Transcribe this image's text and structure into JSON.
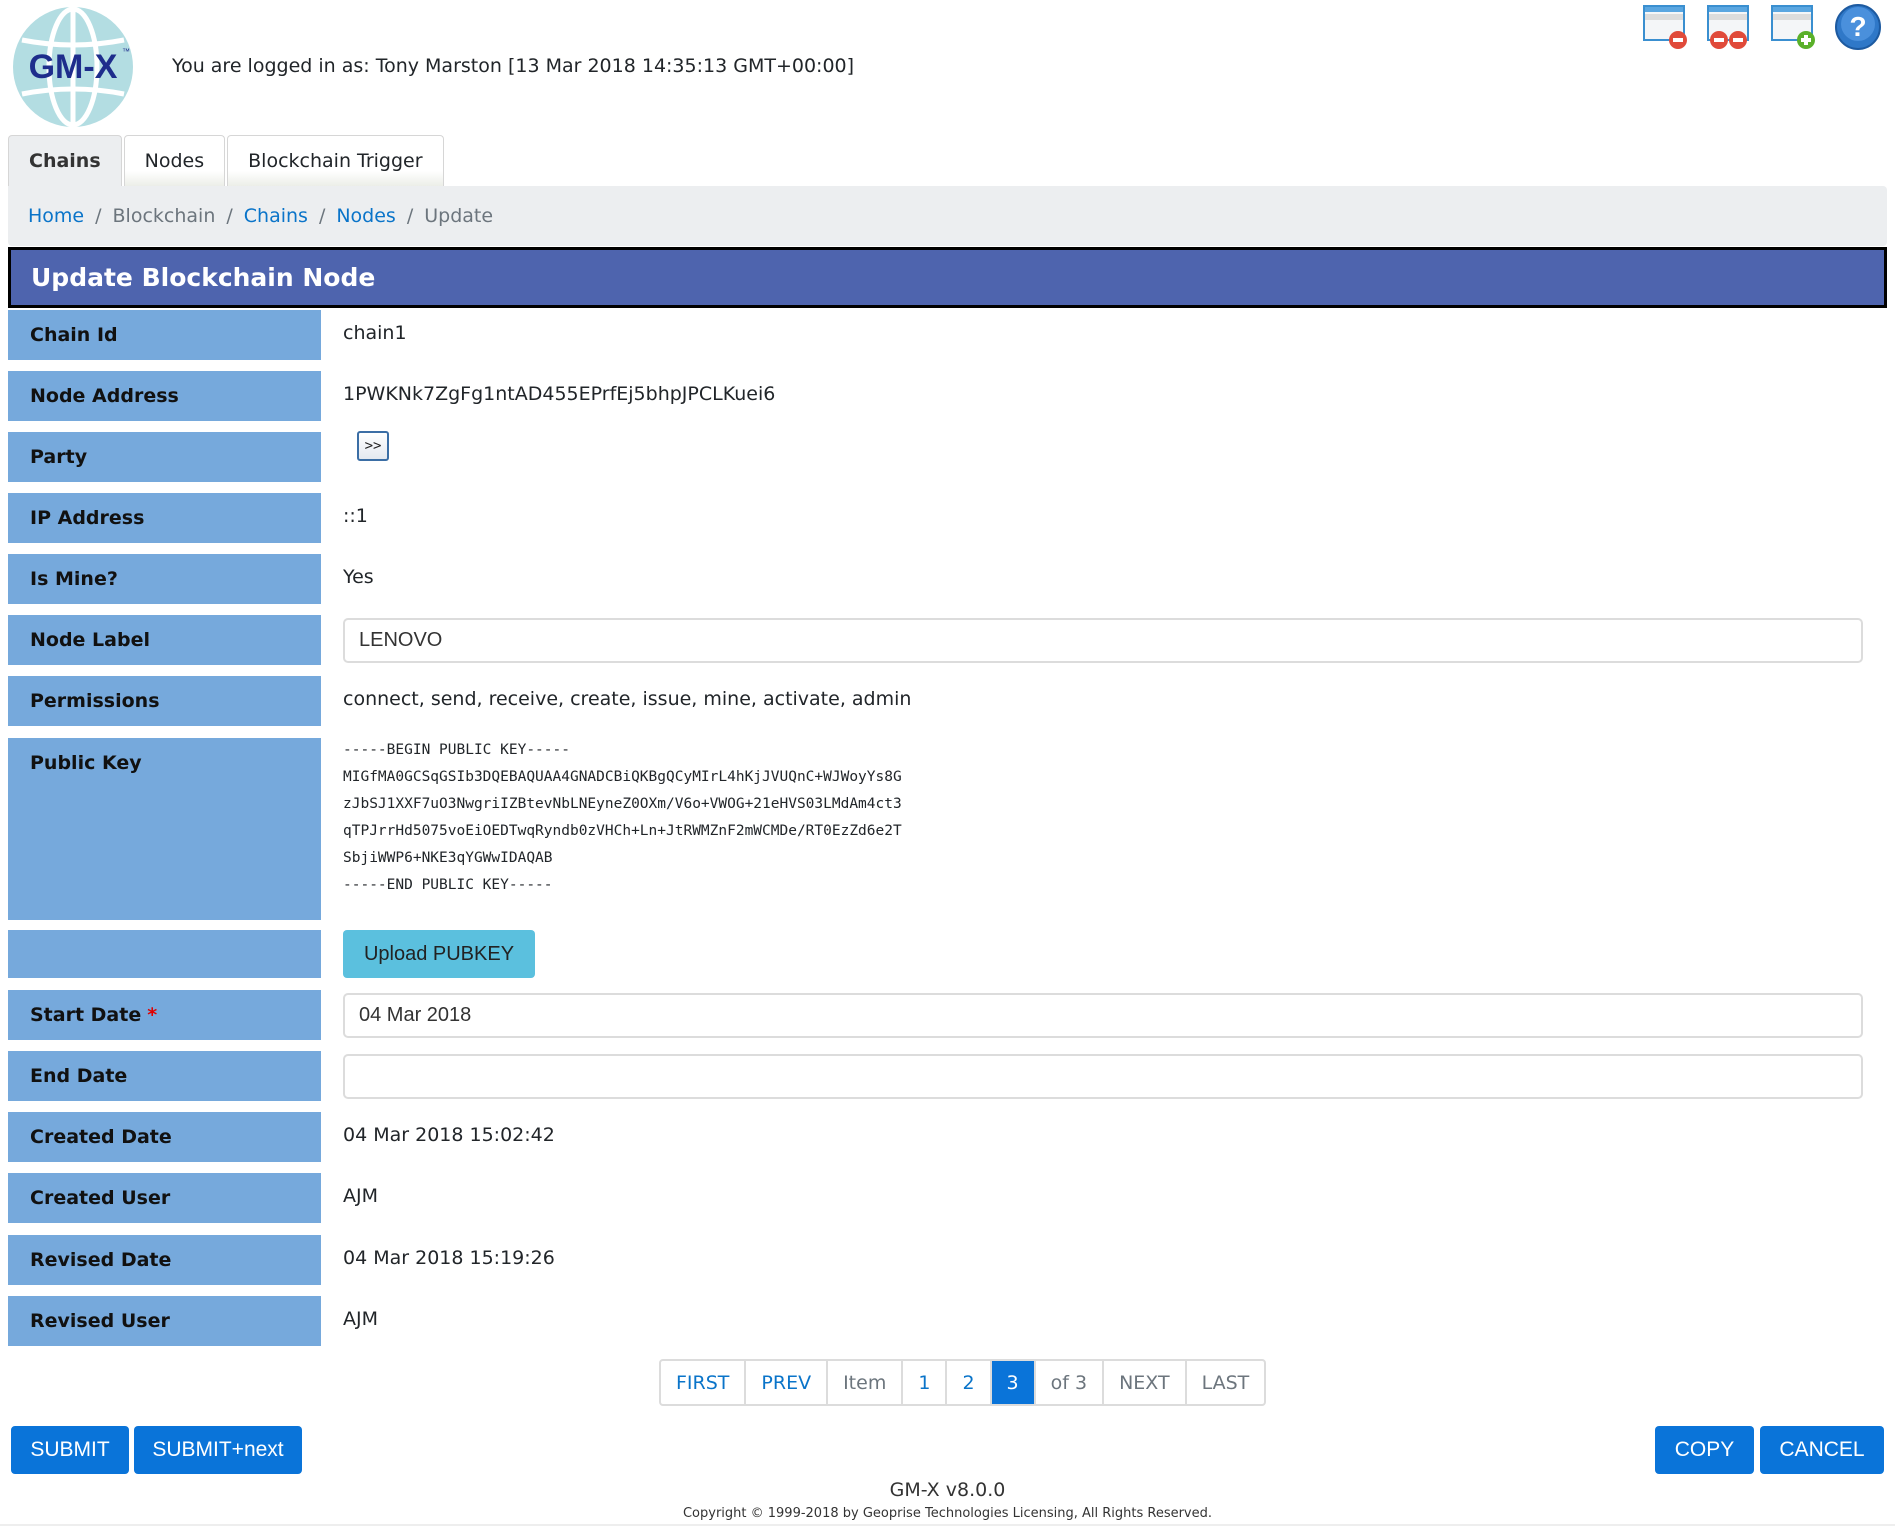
{
  "header": {
    "logo_text": "GM-X",
    "logo_tm": "™",
    "logged_in_text": "You are logged in as: Tony Marston [13 Mar 2018 14:35:13 GMT+00:00]",
    "icons": [
      {
        "name": "close-window-icon"
      },
      {
        "name": "close-all-windows-icon"
      },
      {
        "name": "new-window-icon"
      },
      {
        "name": "help-icon"
      }
    ]
  },
  "tabs": [
    {
      "label": "Chains",
      "active": true
    },
    {
      "label": "Nodes",
      "active": false
    },
    {
      "label": "Blockchain Trigger",
      "active": false
    }
  ],
  "breadcrumb": {
    "items": [
      {
        "label": "Home",
        "link": true
      },
      {
        "label": "Blockchain",
        "link": false
      },
      {
        "label": "Chains",
        "link": true
      },
      {
        "label": "Nodes",
        "link": true
      },
      {
        "label": "Update",
        "link": false
      }
    ],
    "separator": "/"
  },
  "title": "Update Blockchain Node",
  "fields": {
    "chain_id": {
      "label": "Chain Id",
      "value": "chain1"
    },
    "node_address": {
      "label": "Node Address",
      "value": "1PWKNk7ZgFg1ntAD455EPrfEj5bhpJPCLKuei6"
    },
    "party": {
      "label": "Party",
      "button_label": ">>"
    },
    "ip_address": {
      "label": "IP Address",
      "value": "::1"
    },
    "is_mine": {
      "label": "Is Mine?",
      "value": "Yes"
    },
    "node_label": {
      "label": "Node Label",
      "value": "LENOVO"
    },
    "permissions": {
      "label": "Permissions",
      "value": "connect, send, receive, create, issue, mine, activate, admin"
    },
    "public_key": {
      "label": "Public Key",
      "value": "-----BEGIN PUBLIC KEY-----\nMIGfMA0GCSqGSIb3DQEBAQUAA4GNADCBiQKBgQCyMIrL4hKjJVUQnC+WJWoyYs8G\nzJbSJ1XXF7uO3NwgriIZBtevNbLNEyneZ0OXm/V6o+VWOG+21eHVS03LMdAm4ct3\nqTPJrrHd5075voEiOEDTwqRyndb0zVHCh+Ln+JtRWMZnF2mWCMDe/RT0EzZd6e2T\nSbjiWWP6+NKE3qYGWwIDAQAB\n-----END PUBLIC KEY-----"
    },
    "upload": {
      "label": "",
      "button_label": "Upload PUBKEY"
    },
    "start_date": {
      "label": "Start Date",
      "required_mark": "*",
      "value": "04 Mar 2018"
    },
    "end_date": {
      "label": "End Date",
      "value": ""
    },
    "created_date": {
      "label": "Created Date",
      "value": "04 Mar 2018 15:02:42"
    },
    "created_user": {
      "label": "Created User",
      "value": "AJM"
    },
    "revised_date": {
      "label": "Revised Date",
      "value": "04 Mar 2018 15:19:26"
    },
    "revised_user": {
      "label": "Revised User",
      "value": "AJM"
    }
  },
  "pagination": {
    "first": "FIRST",
    "prev": "PREV",
    "item_label": "Item",
    "pages": [
      "1",
      "2",
      "3"
    ],
    "current_page": "3",
    "of_text": "of 3",
    "next": "NEXT",
    "last": "LAST"
  },
  "buttons": {
    "submit": "SUBMIT",
    "submit_next": "SUBMIT+next",
    "copy": "COPY",
    "cancel": "CANCEL"
  },
  "footer": {
    "version": "GM-X v8.0.0",
    "copyright": "Copyright © 1999-2018 by Geoprise Technologies Licensing, All Rights Reserved."
  },
  "colors": {
    "title_bar": "#4e64ae",
    "label_bg": "#76a9dc",
    "primary_button": "#0a74d9",
    "info_button": "#5bc0de",
    "link": "#0a74c9",
    "required": "#e00000"
  }
}
